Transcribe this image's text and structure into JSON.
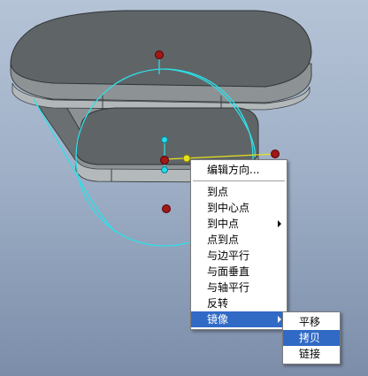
{
  "context_menu": {
    "items": [
      {
        "label": "编辑方向..."
      },
      {
        "label": "到点"
      },
      {
        "label": "到中心点"
      },
      {
        "label": "到中点"
      },
      {
        "label": "点到点"
      },
      {
        "label": "与边平行"
      },
      {
        "label": "与面垂直"
      },
      {
        "label": "与轴平行"
      },
      {
        "label": "反转"
      },
      {
        "label": "镜像"
      }
    ]
  },
  "submenu": {
    "items": [
      {
        "label": "平移"
      },
      {
        "label": "拷贝"
      },
      {
        "label": "链接"
      }
    ]
  },
  "colors": {
    "background_top": "#b5c3d6",
    "background_bottom": "#7c8daa",
    "part_face": "#5e6466",
    "part_side": "#8a9092",
    "handle_ring": "#2ee0e8",
    "handle_point_red": "#a01818",
    "handle_point_cyan": "#26d8e8",
    "handle_point_yellow": "#e8e020",
    "menu_highlight": "#316ac5"
  }
}
